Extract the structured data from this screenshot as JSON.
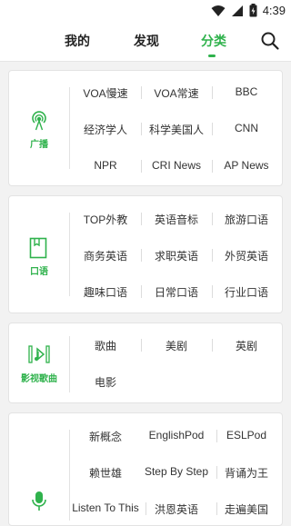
{
  "status": {
    "time": "4:39"
  },
  "tabs": [
    {
      "label": "我的"
    },
    {
      "label": "发现"
    },
    {
      "label": "分类"
    }
  ],
  "colors": {
    "accent": "#2fb24c",
    "text": "#333333",
    "bg": "#f2f2f2"
  },
  "icons": {
    "search": "search-icon"
  },
  "categories": [
    {
      "label": "广播",
      "icon": "radio-tower-icon",
      "items": [
        "VOA慢速",
        "VOA常速",
        "BBC",
        "经济学人",
        "科学美国人",
        "CNN",
        "NPR",
        "CRI News",
        "AP News"
      ]
    },
    {
      "label": "口语",
      "icon": "book-icon",
      "items": [
        "TOP外教",
        "英语音标",
        "旅游口语",
        "商务英语",
        "求职英语",
        "外贸英语",
        "趣味口语",
        "日常口语",
        "行业口语"
      ]
    },
    {
      "label": "影视歌曲",
      "icon": "film-music-icon",
      "items": [
        "歌曲",
        "美剧",
        "英剧",
        "电影"
      ]
    },
    {
      "label": "",
      "icon": "microphone-icon",
      "items": [
        "新概念",
        "EnglishPod",
        "ESLPod",
        "赖世雄",
        "Step By Step",
        "背诵为王",
        "Listen To This",
        "洪恩英语",
        "走遍美国"
      ]
    }
  ]
}
